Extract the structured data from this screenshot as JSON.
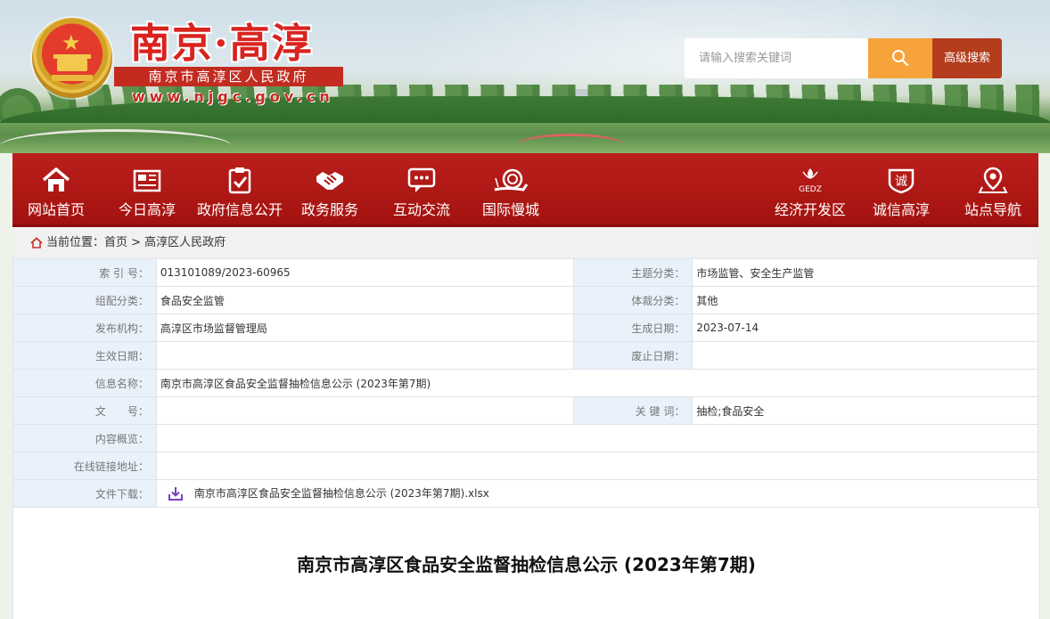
{
  "site": {
    "title": "南京·高淳",
    "subtitle": "南京市高淳区人民政府",
    "url": "www.njgc.gov.cn"
  },
  "search": {
    "placeholder": "请输入搜索关键词",
    "advanced_label": "高级搜索",
    "icon": "search-icon"
  },
  "nav": {
    "left": [
      {
        "label": "网站首页",
        "icon": "home-icon"
      },
      {
        "label": "今日高淳",
        "icon": "newspaper-icon"
      },
      {
        "label": "政府信息公开",
        "icon": "clipboard-check-icon"
      },
      {
        "label": "政务服务",
        "icon": "handshake-icon"
      },
      {
        "label": "互动交流",
        "icon": "chat-icon"
      },
      {
        "label": "国际慢城",
        "icon": "snail-icon"
      }
    ],
    "right": [
      {
        "label": "经济开发区",
        "icon": "gedz-logo-icon",
        "logo_text": "GEDZ"
      },
      {
        "label": "诚信高淳",
        "icon": "integrity-shield-icon",
        "logo_text": "诚"
      },
      {
        "label": "站点导航",
        "icon": "location-pin-icon"
      }
    ]
  },
  "breadcrumb": {
    "text": "当前位置：首页 > 高淳区人民政府"
  },
  "meta": {
    "index_no_label": "索 引 号：",
    "index_no": "013101089/2023-60965",
    "topic_label": "主题分类：",
    "topic": "市场监管、安全生产监管",
    "group_label": "组配分类：",
    "group": "食品安全监管",
    "genre_label": "体裁分类：",
    "genre": "其他",
    "publisher_label": "发布机构：",
    "publisher": "高淳区市场监督管理局",
    "created_label": "生成日期：",
    "created": "2023-07-14",
    "effective_label": "生效日期：",
    "effective": "",
    "expire_label": "废止日期：",
    "expire": "",
    "name_label": "信息名称：",
    "name": "南京市高淳区食品安全监督抽检信息公示 (2023年第7期)",
    "doc_no_label": "文　　号：",
    "doc_no": "",
    "keywords_label": "关 键 词：",
    "keywords": "抽检;食品安全",
    "summary_label": "内容概览：",
    "summary": "",
    "link_label": "在线链接地址：",
    "link": "",
    "download_label": "文件下载：",
    "download_file": "南京市高淳区食品安全监督抽检信息公示 (2023年第7期).xlsx"
  },
  "article": {
    "title": "南京市高淳区食品安全监督抽检信息公示 (2023年第7期)"
  }
}
